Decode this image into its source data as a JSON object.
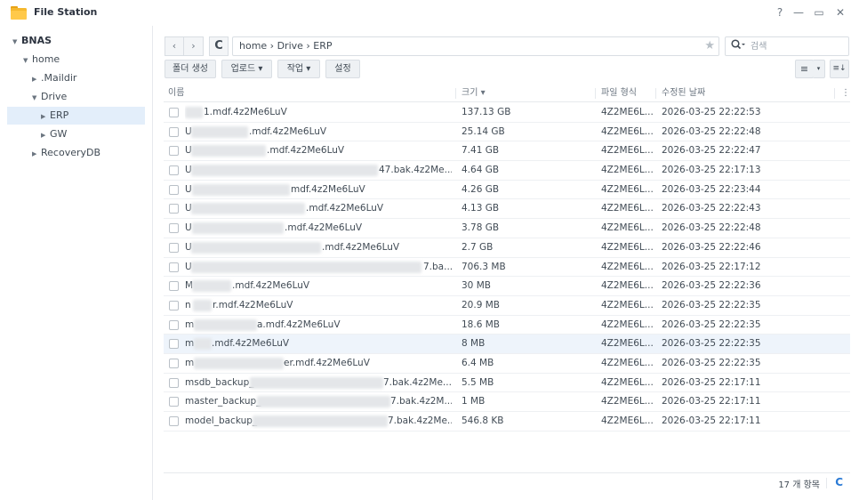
{
  "window": {
    "title": "File Station",
    "help_label": "?",
    "minimize_label": "—",
    "maximize_label": "▭",
    "close_label": "✕"
  },
  "sidebar": {
    "root": "BNAS",
    "home": "home",
    "maildir": ".Maildir",
    "drive": "Drive",
    "erp": "ERP",
    "gw": "GW",
    "recoverydb": "RecoveryDB"
  },
  "toolbar": {
    "back": "‹",
    "forward": "›",
    "refresh": "C",
    "path": "home › Drive › ERP",
    "search_placeholder": "검색",
    "new_folder": "폴더 생성",
    "upload": "업로드 ▾",
    "action": "작업 ▾",
    "settings": "설정",
    "view_list": "≡",
    "view_dropdown": "▾",
    "sort": "≡↓"
  },
  "table": {
    "columns": {
      "name": "이름",
      "size": "크기 ▾",
      "type": "파일 형식",
      "modified": "수정된 날짜",
      "menu": "⋮"
    },
    "rows": [
      {
        "name_head": "",
        "name_tail": "1.mdf.4z2Me6LuV",
        "size": "137.13 GB",
        "type": "4Z2ME6L...",
        "date": "2026-03-25 22:22:53"
      },
      {
        "name_head": "U",
        "name_tail": ".mdf.4z2Me6LuV",
        "size": "25.14 GB",
        "type": "4Z2ME6L...",
        "date": "2026-03-25 22:22:48"
      },
      {
        "name_head": "U",
        "name_tail": ".mdf.4z2Me6LuV",
        "size": "7.41 GB",
        "type": "4Z2ME6L...",
        "date": "2026-03-25 22:22:47"
      },
      {
        "name_head": "U",
        "name_tail": "47.bak.4z2Me...",
        "size": "4.64 GB",
        "type": "4Z2ME6L...",
        "date": "2026-03-25 22:17:13"
      },
      {
        "name_head": "U",
        "name_tail": "mdf.4z2Me6LuV",
        "size": "4.26 GB",
        "type": "4Z2ME6L...",
        "date": "2026-03-25 22:23:44"
      },
      {
        "name_head": "U",
        "name_tail": ".mdf.4z2Me6LuV",
        "size": "4.13 GB",
        "type": "4Z2ME6L...",
        "date": "2026-03-25 22:22:43"
      },
      {
        "name_head": "U",
        "name_tail": ".mdf.4z2Me6LuV",
        "size": "3.78 GB",
        "type": "4Z2ME6L...",
        "date": "2026-03-25 22:22:48"
      },
      {
        "name_head": "U",
        "name_tail": ".mdf.4z2Me6LuV",
        "size": "2.7 GB",
        "type": "4Z2ME6L...",
        "date": "2026-03-25 22:22:46"
      },
      {
        "name_head": "U",
        "name_tail": "7.ba...",
        "size": "706.3 MB",
        "type": "4Z2ME6L...",
        "date": "2026-03-25 22:17:12"
      },
      {
        "name_head": "M",
        "name_tail": ".mdf.4z2Me6LuV",
        "size": "30 MB",
        "type": "4Z2ME6L...",
        "date": "2026-03-25 22:22:36"
      },
      {
        "name_head": "n",
        "name_tail": "r.mdf.4z2Me6LuV",
        "size": "20.9 MB",
        "type": "4Z2ME6L...",
        "date": "2026-03-25 22:22:35"
      },
      {
        "name_head": "m",
        "name_tail": "a.mdf.4z2Me6LuV",
        "size": "18.6 MB",
        "type": "4Z2ME6L...",
        "date": "2026-03-25 22:22:35"
      },
      {
        "name_head": "m",
        "name_tail": ".mdf.4z2Me6LuV",
        "size": "8 MB",
        "type": "4Z2ME6L...",
        "date": "2026-03-25 22:22:35"
      },
      {
        "name_head": "m",
        "name_tail": "er.mdf.4z2Me6LuV",
        "size": "6.4 MB",
        "type": "4Z2ME6L...",
        "date": "2026-03-25 22:22:35"
      },
      {
        "name_head": "msdb_backup_",
        "name_tail": "7.bak.4z2Me...",
        "size": "5.5 MB",
        "type": "4Z2ME6L...",
        "date": "2026-03-25 22:17:11"
      },
      {
        "name_head": "master_backup_",
        "name_tail": "7.bak.4z2M...",
        "size": "1 MB",
        "type": "4Z2ME6L...",
        "date": "2026-03-25 22:17:11"
      },
      {
        "name_head": "model_backup_",
        "name_tail": "7.bak.4z2Me...",
        "size": "546.8 KB",
        "type": "4Z2ME6L...",
        "date": "2026-03-25 22:17:11"
      }
    ]
  },
  "footer": {
    "item_count": "17 개 항목",
    "refresh": "C"
  }
}
